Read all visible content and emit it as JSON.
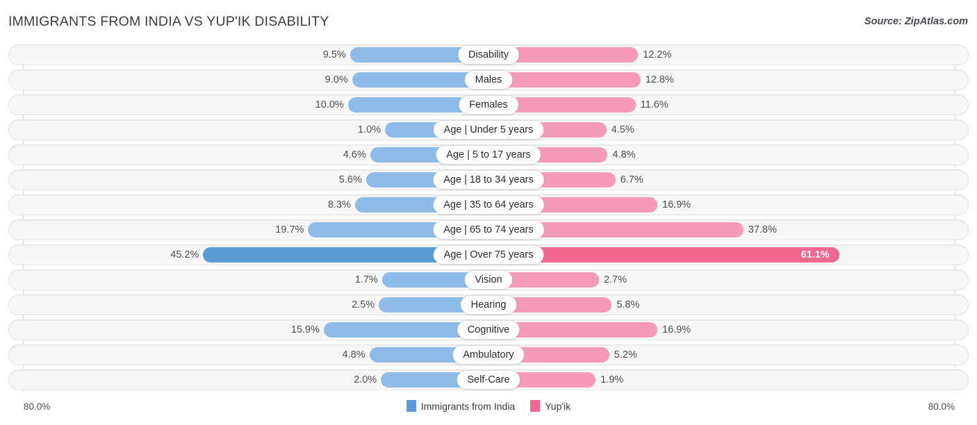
{
  "header": {
    "title": "IMMIGRANTS FROM INDIA VS YUP'IK DISABILITY",
    "source": "Source: ZipAtlas.com"
  },
  "axis": {
    "left_max_label": "80.0%",
    "right_max_label": "80.0%",
    "max_value": 80.0
  },
  "legend": {
    "items": [
      {
        "label": "Immigrants from India",
        "color": "#5b9bd5"
      },
      {
        "label": "Yup'ik",
        "color": "#f2678f"
      }
    ]
  },
  "colors": {
    "left_bar": "#8fbbe8",
    "right_bar": "#f59ab9",
    "left_bar_peak": "#5b9bd5",
    "right_bar_peak": "#f2678f",
    "track": "#f7f7f7",
    "gridline": "#d9d9d9"
  },
  "chart_data": {
    "type": "bar",
    "subtype": "diverging-bidirectional",
    "title": "IMMIGRANTS FROM INDIA VS YUP'IK DISABILITY",
    "xlabel": "",
    "ylabel": "",
    "xlim": [
      0,
      80
    ],
    "grid": true,
    "legend_position": "bottom-center",
    "units": "percent",
    "categories": [
      "Disability",
      "Males",
      "Females",
      "Age | Under 5 years",
      "Age | 5 to 17 years",
      "Age | 18 to 34 years",
      "Age | 35 to 64 years",
      "Age | 65 to 74 years",
      "Age | Over 75 years",
      "Vision",
      "Hearing",
      "Cognitive",
      "Ambulatory",
      "Self-Care"
    ],
    "series": [
      {
        "name": "Immigrants from India",
        "side": "left",
        "color": "#8fbbe8",
        "values": [
          9.5,
          9.0,
          10.0,
          1.0,
          4.6,
          5.6,
          8.3,
          19.7,
          45.2,
          1.7,
          2.5,
          15.9,
          4.8,
          2.0
        ],
        "labels": [
          "9.5%",
          "9.0%",
          "10.0%",
          "1.0%",
          "4.6%",
          "5.6%",
          "8.3%",
          "19.7%",
          "45.2%",
          "1.7%",
          "2.5%",
          "15.9%",
          "4.8%",
          "2.0%"
        ]
      },
      {
        "name": "Yup'ik",
        "side": "right",
        "color": "#f59ab9",
        "values": [
          12.2,
          12.8,
          11.6,
          4.5,
          4.8,
          6.7,
          16.9,
          37.8,
          61.1,
          2.7,
          5.8,
          16.9,
          5.2,
          1.9
        ],
        "labels": [
          "12.2%",
          "12.8%",
          "11.6%",
          "4.5%",
          "4.8%",
          "6.7%",
          "16.9%",
          "37.8%",
          "61.1%",
          "2.7%",
          "5.8%",
          "16.9%",
          "5.2%",
          "1.9%"
        ]
      }
    ],
    "highlighted_category": "Age | Over 75 years"
  },
  "rows": [
    {
      "label": "Disability",
      "left": "9.5%",
      "right": "12.2%",
      "lv": 9.5,
      "rv": 12.2,
      "peak": false
    },
    {
      "label": "Males",
      "left": "9.0%",
      "right": "12.8%",
      "lv": 9.0,
      "rv": 12.8,
      "peak": false
    },
    {
      "label": "Females",
      "left": "10.0%",
      "right": "11.6%",
      "lv": 10.0,
      "rv": 11.6,
      "peak": false
    },
    {
      "label": "Age | Under 5 years",
      "left": "1.0%",
      "right": "4.5%",
      "lv": 1.0,
      "rv": 4.5,
      "peak": false
    },
    {
      "label": "Age | 5 to 17 years",
      "left": "4.6%",
      "right": "4.8%",
      "lv": 4.6,
      "rv": 4.8,
      "peak": false
    },
    {
      "label": "Age | 18 to 34 years",
      "left": "5.6%",
      "right": "6.7%",
      "lv": 5.6,
      "rv": 6.7,
      "peak": false
    },
    {
      "label": "Age | 35 to 64 years",
      "left": "8.3%",
      "right": "16.9%",
      "lv": 8.3,
      "rv": 16.9,
      "peak": false
    },
    {
      "label": "Age | 65 to 74 years",
      "left": "19.7%",
      "right": "37.8%",
      "lv": 19.7,
      "rv": 37.8,
      "peak": false
    },
    {
      "label": "Age | Over 75 years",
      "left": "45.2%",
      "right": "61.1%",
      "lv": 45.2,
      "rv": 61.1,
      "peak": true
    },
    {
      "label": "Vision",
      "left": "1.7%",
      "right": "2.7%",
      "lv": 1.7,
      "rv": 2.7,
      "peak": false
    },
    {
      "label": "Hearing",
      "left": "2.5%",
      "right": "5.8%",
      "lv": 2.5,
      "rv": 5.8,
      "peak": false
    },
    {
      "label": "Cognitive",
      "left": "15.9%",
      "right": "16.9%",
      "lv": 15.9,
      "rv": 16.9,
      "peak": false
    },
    {
      "label": "Ambulatory",
      "left": "4.8%",
      "right": "5.2%",
      "lv": 4.8,
      "rv": 5.2,
      "peak": false
    },
    {
      "label": "Self-Care",
      "left": "2.0%",
      "right": "1.9%",
      "lv": 2.0,
      "rv": 1.9,
      "peak": false
    }
  ]
}
